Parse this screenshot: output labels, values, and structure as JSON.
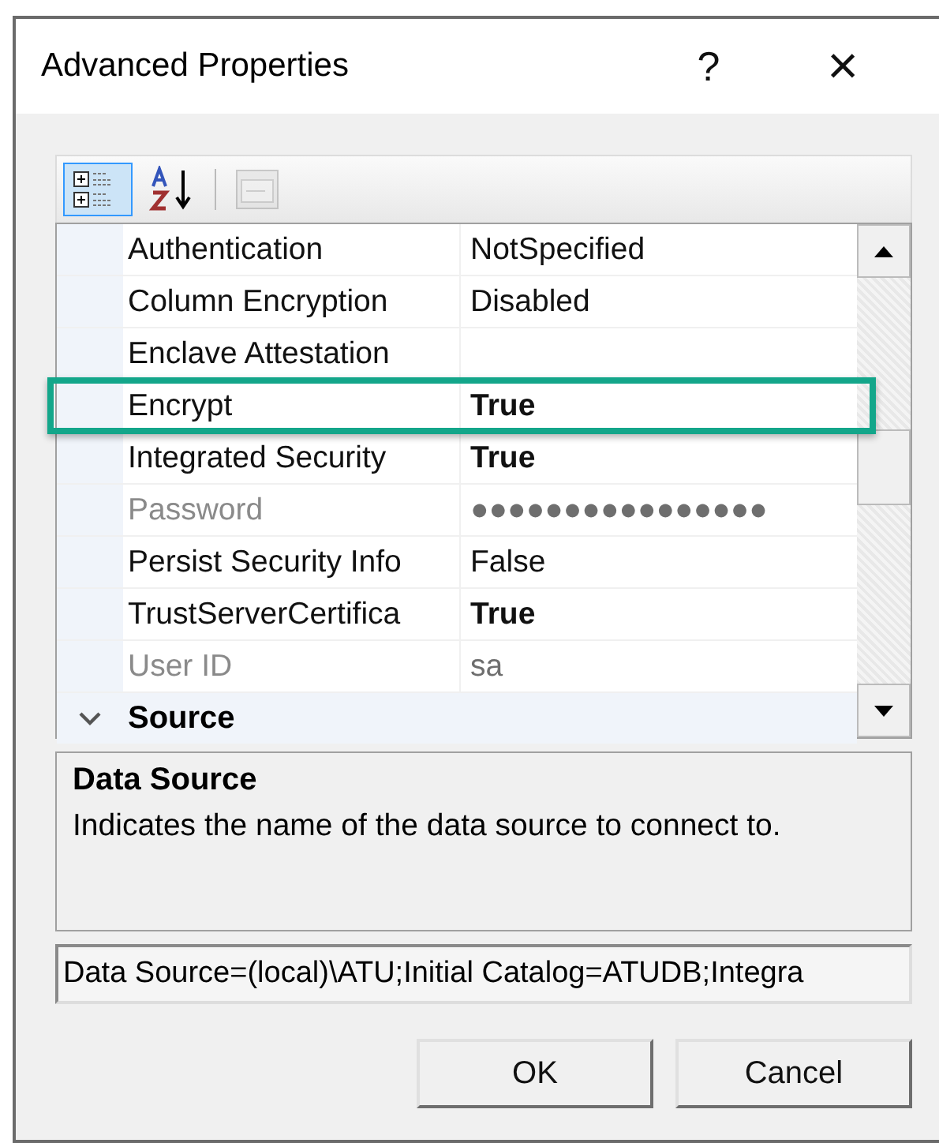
{
  "window": {
    "title": "Advanced Properties",
    "help": "?",
    "close": "×"
  },
  "toolbar": [
    {
      "kind": "categorized",
      "selected": true,
      "disabled": false
    },
    {
      "kind": "alphabetical",
      "selected": false,
      "disabled": false
    },
    {
      "kind": "pages",
      "selected": false,
      "disabled": true
    }
  ],
  "grid": {
    "rows": [
      {
        "kind": "property",
        "name": "Authentication",
        "value": "NotSpecified",
        "modified": false,
        "disabled": false,
        "highlighted": false
      },
      {
        "kind": "property",
        "name": "Column Encryption",
        "value": "Disabled",
        "modified": false,
        "disabled": false,
        "highlighted": false
      },
      {
        "kind": "property",
        "name": "Enclave Attestation",
        "disabled": false,
        "highlighted": false
      },
      {
        "kind": "property",
        "name": "Encrypt",
        "value": "True",
        "modified": true,
        "disabled": false,
        "highlighted": true
      },
      {
        "kind": "property",
        "name": "Integrated Security",
        "value": "True",
        "modified": true,
        "disabled": false,
        "highlighted": false
      },
      {
        "kind": "property",
        "name": "Password",
        "value": "●●●●●●●●●●●●●●●●",
        "modified": false,
        "disabled": true,
        "highlighted": false
      },
      {
        "kind": "property",
        "name": "Persist Security Info",
        "value": "False",
        "modified": false,
        "disabled": false,
        "highlighted": false
      },
      {
        "kind": "property",
        "name": "TrustServerCertifica",
        "value": "True",
        "modified": true,
        "disabled": false,
        "highlighted": false
      },
      {
        "kind": "property",
        "name": "User ID",
        "value": "sa",
        "modified": false,
        "disabled": true,
        "highlighted": false
      },
      {
        "kind": "category",
        "name": "Source",
        "expanded": true
      }
    ]
  },
  "description": {
    "title": "Data Source",
    "text": "Indicates the name of the data source to connect to."
  },
  "connection_string": {
    "value": "Data Source=(local)\\ATU;Initial Catalog=ATUDB;Integra"
  },
  "buttons": [
    "OK",
    "Cancel"
  ]
}
